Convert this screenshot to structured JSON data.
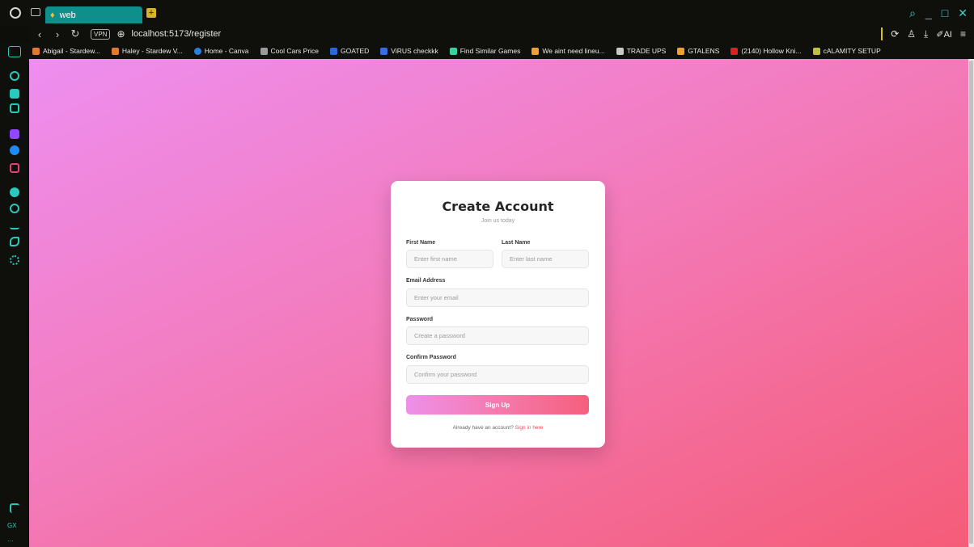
{
  "browser": {
    "tab": {
      "title": "web"
    },
    "address": {
      "url": "localhost:5173/register",
      "vpn_label": "VPN"
    },
    "window_controls": [
      "search",
      "minimize",
      "maximize",
      "close"
    ],
    "ai_label": "AI"
  },
  "bookmarks": [
    {
      "label": "Abigail - Stardew...",
      "color": "#e07a2c"
    },
    {
      "label": "Haley - Stardew V...",
      "color": "#e07a2c"
    },
    {
      "label": "Home - Canva",
      "color": "#2a7fd8"
    },
    {
      "label": "Cool Cars Price",
      "color": "#9a9a9a"
    },
    {
      "label": "GOATED",
      "color": "#2a6ad8"
    },
    {
      "label": "ViRUS checkkk",
      "color": "#3b6de0"
    },
    {
      "label": "Find Similar Games",
      "color": "#3ad0a0"
    },
    {
      "label": "We aint need lineu...",
      "color": "#f0a030"
    },
    {
      "label": "TRADE UPS",
      "color": "#c8c8c8"
    },
    {
      "label": "GTALENS",
      "color": "#f0a030"
    },
    {
      "label": "(2140) Hollow Kni...",
      "color": "#e02020"
    },
    {
      "label": "cALAMITY SETUP",
      "color": "#c0c040"
    }
  ],
  "sidebar": {
    "bottom_label": "GX",
    "icons": [
      {
        "name": "refresh-icon",
        "color": "#29c9bd"
      },
      {
        "name": "chat-icon",
        "color": "#29c9bd"
      },
      {
        "name": "mail-icon",
        "color": "#29c9bd"
      },
      {
        "name": "twitch-icon",
        "color": "#9146ff"
      },
      {
        "name": "messenger-icon",
        "color": "#1e8bf5"
      },
      {
        "name": "instagram-icon",
        "color": "#e2407a"
      },
      {
        "name": "spotify-icon",
        "color": "#29c9bd"
      },
      {
        "name": "history-icon",
        "color": "#29c9bd"
      },
      {
        "name": "download-icon",
        "color": "#29c9bd"
      },
      {
        "name": "extensions-icon",
        "color": "#29c9bd"
      },
      {
        "name": "settings-icon",
        "color": "#29c9bd"
      }
    ]
  },
  "form": {
    "title": "Create Account",
    "subtitle": "Join us today",
    "first_name": {
      "label": "First Name",
      "placeholder": "Enter first name"
    },
    "last_name": {
      "label": "Last Name",
      "placeholder": "Enter last name"
    },
    "email": {
      "label": "Email Address",
      "placeholder": "Enter your email"
    },
    "password": {
      "label": "Password",
      "placeholder": "Create a password"
    },
    "confirm_password": {
      "label": "Confirm Password",
      "placeholder": "Confirm your password"
    },
    "submit_label": "Sign Up",
    "footer_text": "Already have an account?",
    "footer_link": "Sign in here"
  }
}
